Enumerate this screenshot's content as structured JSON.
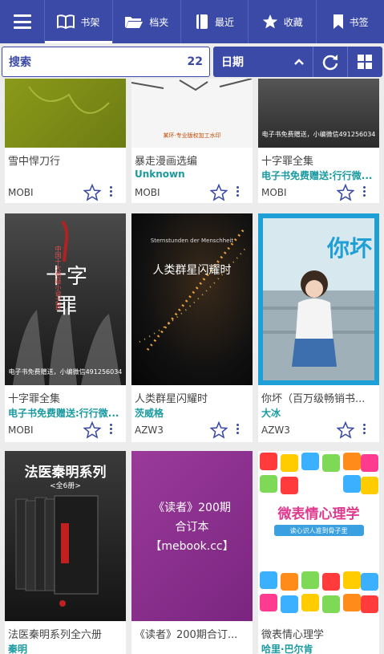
{
  "nav": {
    "tabs": [
      {
        "label": "书架",
        "icon": "book-open-icon"
      },
      {
        "label": "档夹",
        "icon": "folder-icon"
      },
      {
        "label": "最近",
        "icon": "recent-book-icon"
      },
      {
        "label": "收藏",
        "icon": "star-icon"
      },
      {
        "label": "书签",
        "icon": "bookmark-icon"
      }
    ]
  },
  "toolbar": {
    "search_label": "搜索",
    "count": "22",
    "sort_label": "日期"
  },
  "books": [
    {
      "title": "雪中悍刀行",
      "author": "",
      "format": "MOBI"
    },
    {
      "title": "暴走漫画选编",
      "author": "Unknown",
      "format": "MOBI",
      "cover_text": "某环·专业版权加工水印"
    },
    {
      "title": "十字罪全集",
      "author": "电子书免费赠送:行行微...",
      "format": "MOBI",
      "cover_text": "电子书免费赠送，小编微信491256034"
    },
    {
      "title": "十字罪全集",
      "author": "电子书免费赠送:行行微...",
      "format": "MOBI",
      "cover_title": "十字罪",
      "cover_sub": "中国十大悬疑小说之首",
      "cover_text": "电子书免费赠送，小编微信491256034"
    },
    {
      "title": "人类群星闪耀时",
      "author": "茨威格",
      "format": "AZW3",
      "cover_title": "人类群星闪耀时",
      "cover_sub": "Sternstunden der Menschheit"
    },
    {
      "title": "你坏（百万级畅销书...",
      "author": "大冰",
      "format": "AZW3",
      "cover_title": "你坏"
    },
    {
      "title": "法医秦明系列全六册",
      "author": "秦明",
      "format": "",
      "cover_title": "法医秦明系列",
      "cover_sub": "<全6册>"
    },
    {
      "title": "《读者》200期合订...",
      "author": "",
      "format": "",
      "cover_title": "《读者》200期",
      "cover_sub": "合订本",
      "cover_text": "【mebook.cc】"
    },
    {
      "title": "微表情心理学",
      "author": "哈里·巴尔肯",
      "format": "",
      "cover_title": "微表情心理学",
      "cover_sub": "读心识人准到骨子里"
    }
  ]
}
